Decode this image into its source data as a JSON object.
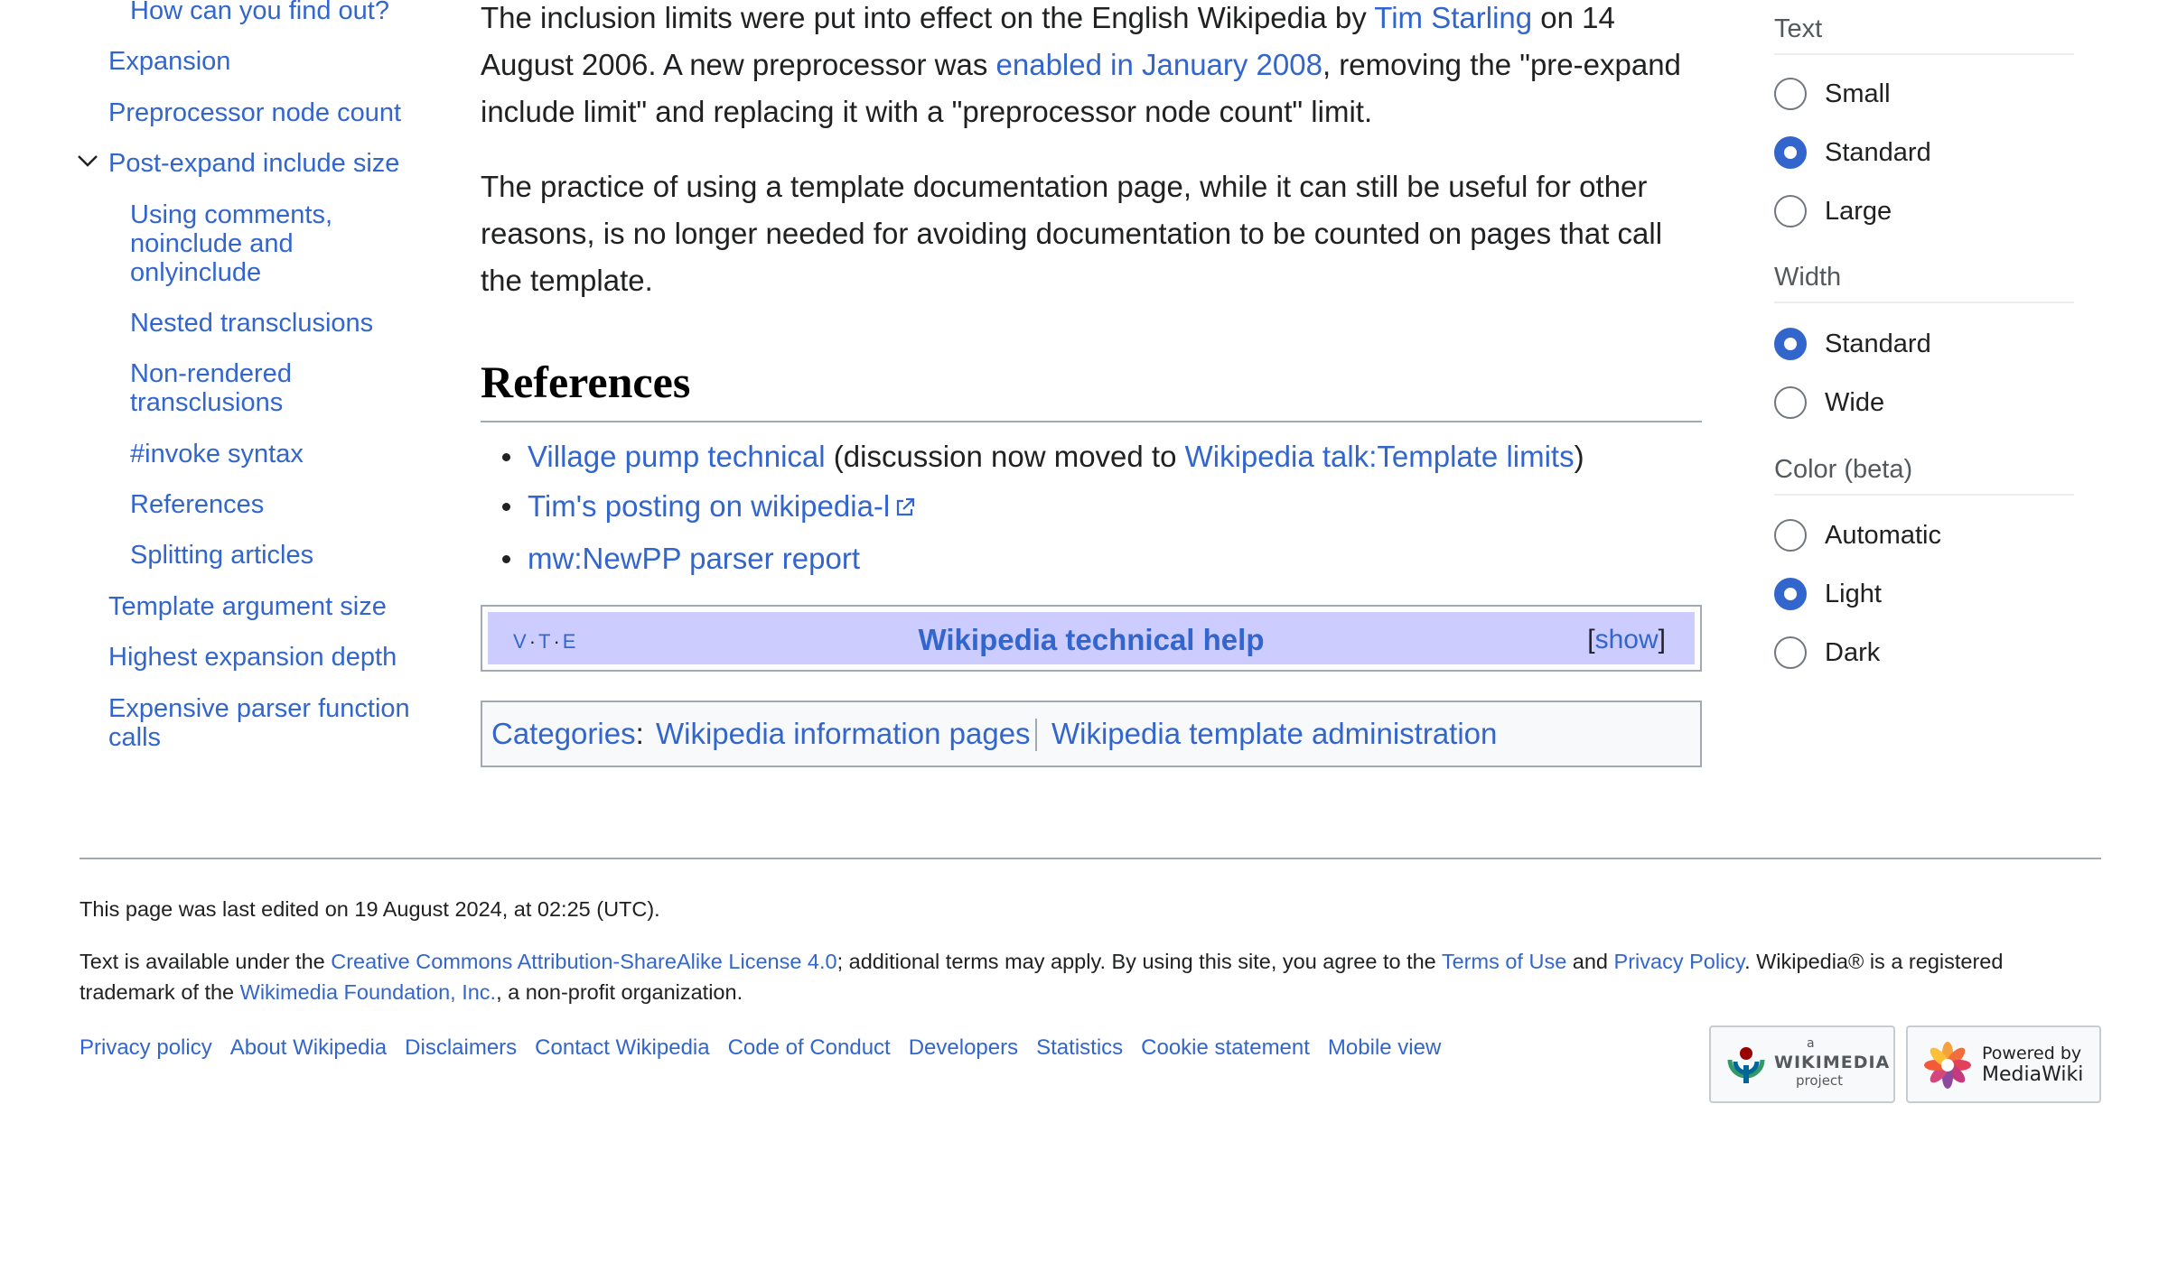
{
  "toc": {
    "items": [
      {
        "label": "How can you find out?"
      },
      {
        "label": "Expansion"
      },
      {
        "label": "Preprocessor node count"
      },
      {
        "label": "Post-expand include size"
      },
      {
        "label": "Using comments, noinclude and onlyinclude"
      },
      {
        "label": "Nested transclusions"
      },
      {
        "label": "Non-rendered transclusions"
      },
      {
        "label": "#invoke syntax"
      },
      {
        "label": "References"
      },
      {
        "label": "Splitting articles"
      },
      {
        "label": "Template argument size"
      },
      {
        "label": "Highest expansion depth"
      },
      {
        "label": "Expensive parser function calls"
      }
    ]
  },
  "content": {
    "para1": {
      "t1": "The inclusion limits were put into effect on the English Wikipedia by ",
      "link1": "Tim Starling",
      "t2": " on 14 August 2006. A new preprocessor was ",
      "link2": "enabled in January 2008",
      "t3": ", removing the \"pre-expand include limit\" and replacing it with a \"preprocessor node count\" limit."
    },
    "para2": "The practice of using a template documentation page, while it can still be useful for other reasons, is no longer needed for avoiding documentation to be counted on pages that call the template.",
    "references_heading": "References",
    "refs": {
      "r1_link": "Village pump technical",
      "r1_text_a": " (discussion now moved to ",
      "r1_link2": "Wikipedia talk:Template limits",
      "r1_text_b": ")",
      "r2_link": "Tim's posting on wikipedia-l",
      "r3_link": "mw:NewPP parser report"
    },
    "navbox": {
      "v": "V",
      "t": "T",
      "e": "E",
      "dot": "·",
      "title": "Wikipedia technical help",
      "bracket_open": "[",
      "show": "show",
      "bracket_close": "]"
    },
    "categories": {
      "label": "Categories",
      "colon": ":",
      "items": [
        "Wikipedia information pages",
        "Wikipedia template administration"
      ]
    }
  },
  "appearance": {
    "text_heading": "Text",
    "text_options": [
      "Small",
      "Standard",
      "Large"
    ],
    "text_selected": "Standard",
    "width_heading": "Width",
    "width_options": [
      "Standard",
      "Wide"
    ],
    "width_selected": "Standard",
    "color_heading": "Color (beta)",
    "color_options": [
      "Automatic",
      "Light",
      "Dark"
    ],
    "color_selected": "Light",
    "accent": "#3366cc"
  },
  "footer": {
    "last_edited": "This page was last edited on 19 August 2024, at 02:25 (UTC).",
    "license": {
      "t1": "Text is available under the ",
      "l1": "Creative Commons Attribution-ShareAlike License 4.0",
      "t2": "; additional terms may apply. By using this site, you agree to the ",
      "l2": "Terms of Use",
      "t3": " and ",
      "l3": "Privacy Policy",
      "t4": ". Wikipedia® is a registered trademark of the ",
      "l4": "Wikimedia Foundation, Inc.",
      "t5": ", a non-profit organization."
    },
    "links": [
      "Privacy policy",
      "About Wikipedia",
      "Disclaimers",
      "Contact Wikipedia",
      "Code of Conduct",
      "Developers",
      "Statistics",
      "Cookie statement",
      "Mobile view"
    ],
    "badge_wikimedia": {
      "top": "a",
      "name": "WIKIMEDIA",
      "bottom": "project"
    },
    "badge_mediawiki": {
      "top": "Powered by",
      "name": "MediaWiki"
    }
  }
}
